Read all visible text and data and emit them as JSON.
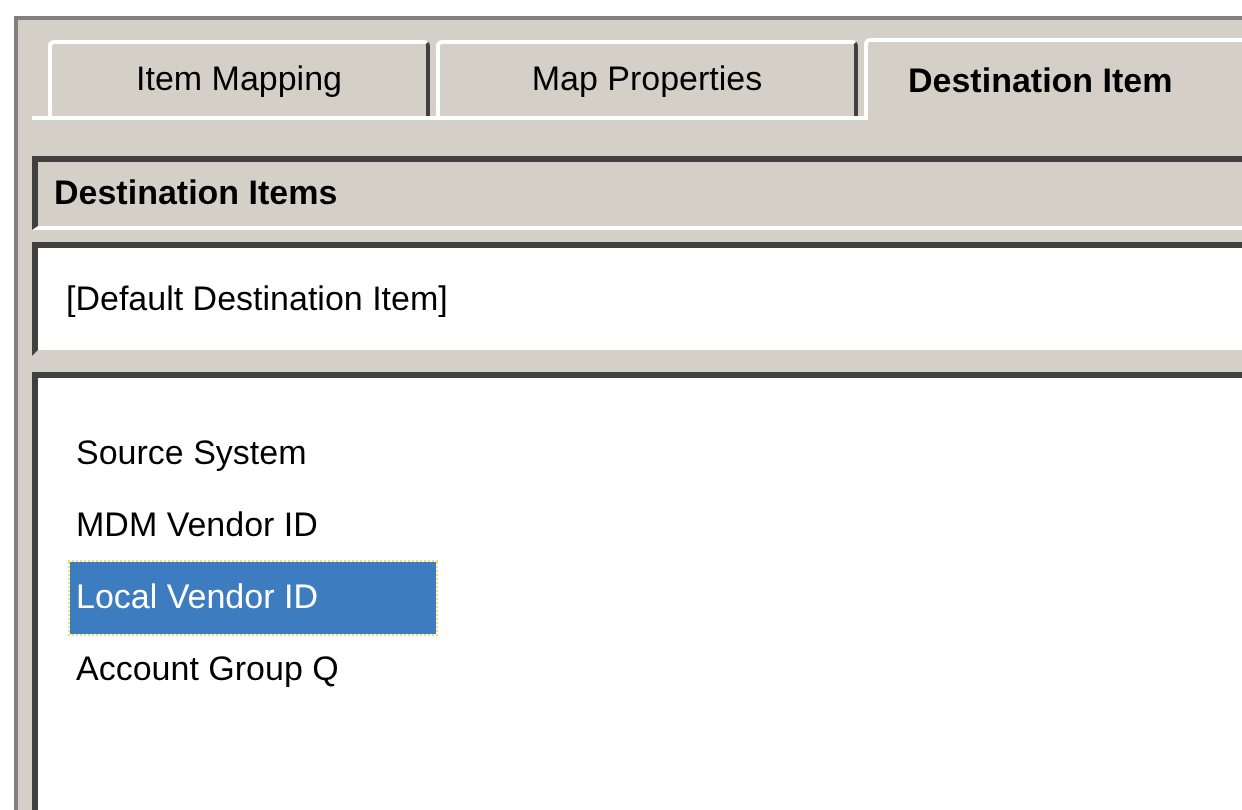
{
  "tabs": [
    {
      "label": "Item Mapping",
      "selected": false
    },
    {
      "label": "Map Properties",
      "selected": false
    },
    {
      "label": "Destination Item",
      "selected": true
    }
  ],
  "panel": {
    "title": "Destination Items"
  },
  "default_item": {
    "value": "[Default Destination Item]"
  },
  "items": [
    {
      "label": "Source System",
      "selected": false
    },
    {
      "label": "MDM Vendor ID",
      "selected": false
    },
    {
      "label": "Local Vendor ID",
      "selected": true
    },
    {
      "label": "Account Group Q",
      "selected": false
    }
  ]
}
